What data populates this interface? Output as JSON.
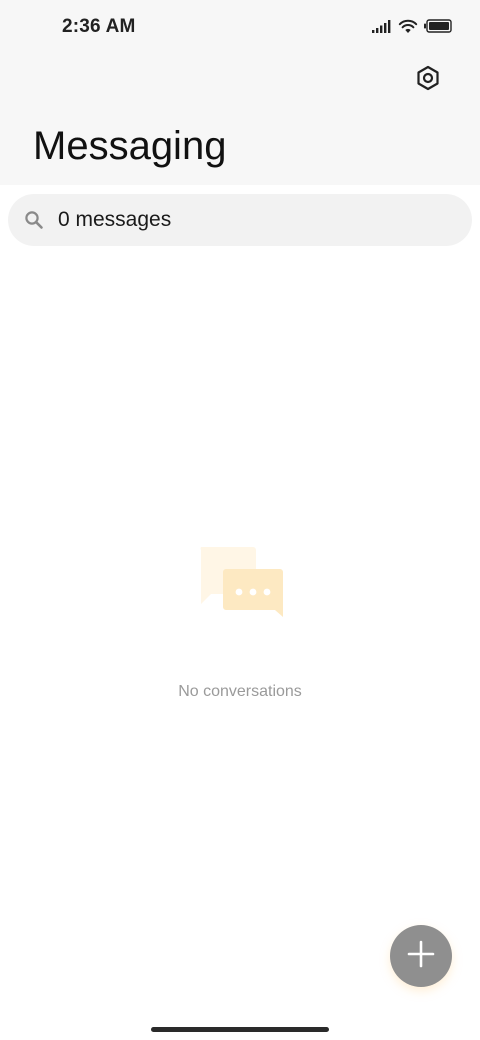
{
  "status_bar": {
    "time": "2:36 AM",
    "icons": [
      "signal-icon",
      "wifi-icon",
      "battery-icon"
    ]
  },
  "header": {
    "title": "Messaging",
    "settings_icon": "settings-icon"
  },
  "search": {
    "text": "0 messages",
    "icon": "search-icon"
  },
  "empty_state": {
    "illustration": "chat-bubbles-icon",
    "message": "No conversations"
  },
  "fab": {
    "icon": "plus-icon"
  },
  "colors": {
    "header_background": "#f7f7f7",
    "search_background": "#f2f2f2",
    "fab_background": "#8f8f8f",
    "illustration_accent": "#fde9c2",
    "empty_text": "#9a9a9a"
  }
}
